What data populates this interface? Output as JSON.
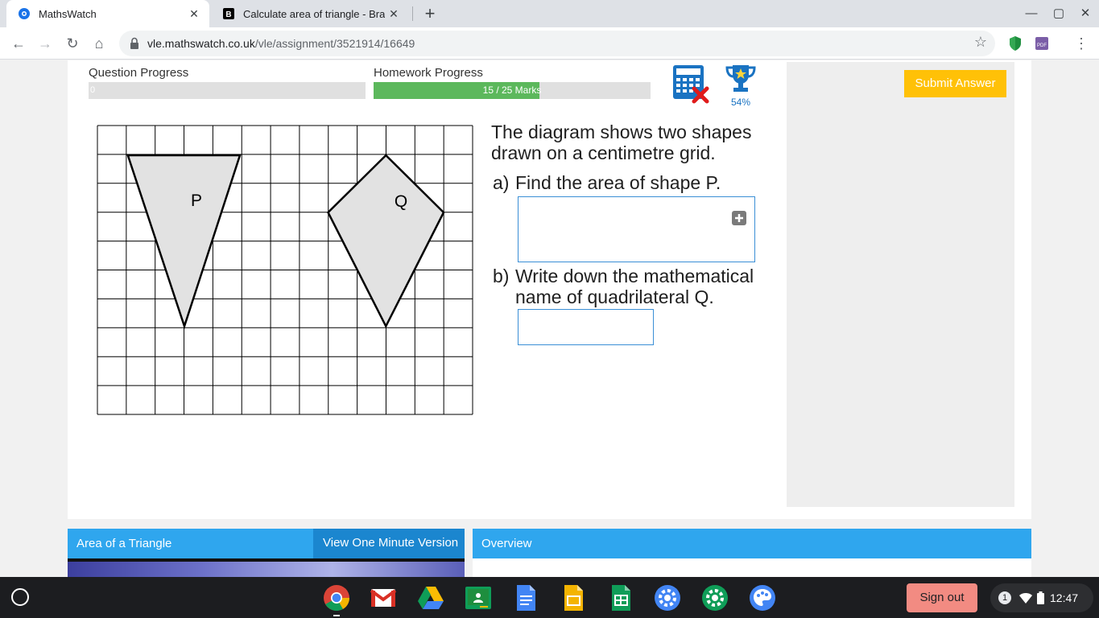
{
  "browser": {
    "tabs": [
      {
        "title": "MathsWatch",
        "close": "✕"
      },
      {
        "title": "Calculate area of triangle - Brainly",
        "close": "✕"
      }
    ],
    "new_tab": "+",
    "window_controls": {
      "minimize": "—",
      "maximize": "▢",
      "close": "✕"
    },
    "nav": {
      "back": "←",
      "forward": "→",
      "reload": "↻",
      "home": "⌂"
    },
    "url_domain": "vle.mathswatch.co.uk",
    "url_path": "/vle/assignment/3521914/16649",
    "bookmark_star": "☆",
    "menu": "⋮"
  },
  "progress": {
    "question_label": "Question Progress",
    "question_value": 0,
    "question_text": "0",
    "homework_label": "Homework Progress",
    "homework_text": "15 / 25 Marks",
    "homework_fraction": 0.6
  },
  "calculator_icon": "calculator-not-allowed-icon",
  "trophy_percent": "54%",
  "submit_label": "Submit Answer",
  "question": {
    "intro_line1": "The diagram shows two shapes",
    "intro_line2": "drawn on a centimetre grid.",
    "a_label": "a)",
    "a_text": "Find the area of shape P.",
    "b_label": "b)",
    "b_text_line1": "Write down the mathematical",
    "b_text_line2": "name of quadrilateral Q."
  },
  "diagram": {
    "grid_cols": 13,
    "grid_rows": 10,
    "shape_p_label": "P",
    "shape_q_label": "Q",
    "shape_fill": "#e2e2e2"
  },
  "bottom": {
    "video_title": "Area of a Triangle",
    "one_minute": "View One Minute Version",
    "overview": "Overview"
  },
  "shelf": {
    "sign_out": "Sign out",
    "notifications": "1",
    "time": "12:47"
  },
  "colors": {
    "accent_blue": "#2fa6ee",
    "submit_yellow": "#ffc107",
    "progress_green": "#5cb85c",
    "input_border": "#3a8fd6"
  }
}
